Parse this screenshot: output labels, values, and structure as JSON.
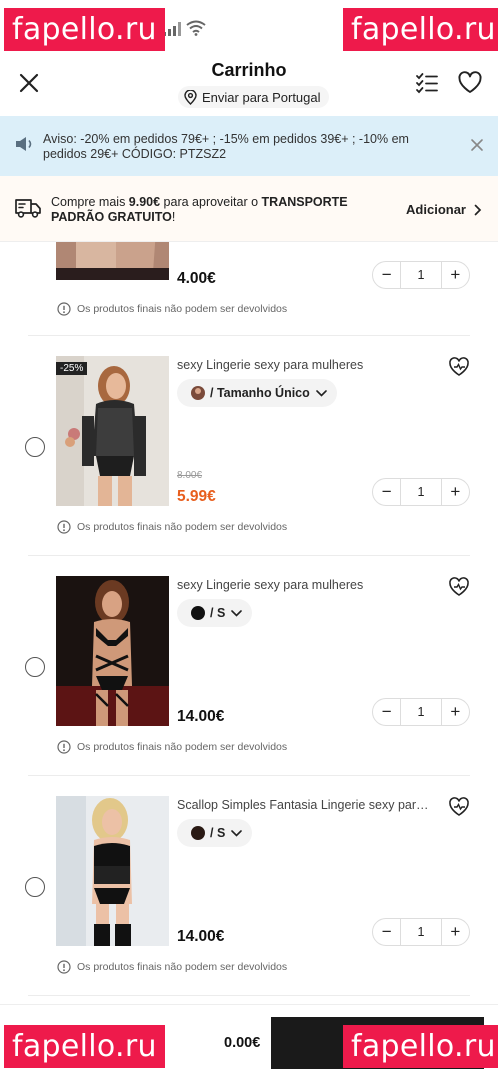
{
  "watermark": "fapello.ru",
  "header": {
    "title": "Carrinho",
    "ship_to": "Enviar para Portugal"
  },
  "notice": {
    "text": "Aviso: -20% em pedidos 79€+ ; -15% em pedidos 39€+ ; -10% em pedidos 29€+ CÓDIGO: PTZSZ2"
  },
  "promo": {
    "text_prefix": "Compre mais ",
    "amount": "9.90€",
    "text_mid": " para aproveitar o ",
    "highlight": "TRANSPORTE PADRÃO GRATUITO",
    "text_suffix": "!",
    "add_label": "Adicionar"
  },
  "items": [
    {
      "name": "",
      "variant": "",
      "old_price": "",
      "price": "4.00€",
      "quantity": "1",
      "notice": "Os produtos finais não podem ser devolvidos"
    },
    {
      "discount": "-25%",
      "name": "sexy Lingerie sexy para mulheres",
      "variant": "/ Tamanho Único",
      "old_price": "8.00€",
      "price": "5.99€",
      "quantity": "1",
      "notice": "Os produtos finais não podem ser devolvidos"
    },
    {
      "name": "sexy Lingerie sexy para mulheres",
      "variant": "/ S",
      "price": "14.00€",
      "quantity": "1",
      "notice": "Os produtos finais não podem ser devolvidos"
    },
    {
      "name": "Scallop Simples Fantasia Lingerie sexy para mulheres",
      "variant": "/ S",
      "price": "14.00€",
      "quantity": "1",
      "notice": "Os produtos finais não podem ser devolvidos"
    }
  ],
  "footer": {
    "total": "0.00€"
  },
  "colors": {
    "sale_price": "#e85e1d",
    "notice_bg": "#dceff9",
    "watermark_bg": "#ee1a4b"
  }
}
